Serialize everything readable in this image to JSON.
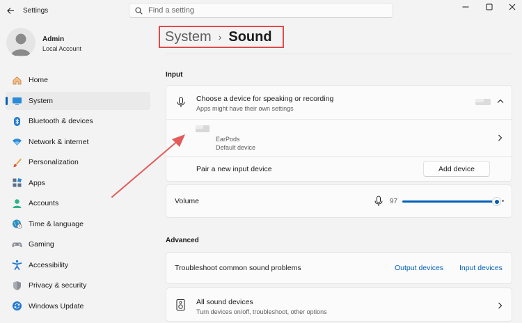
{
  "app": {
    "title": "Settings"
  },
  "search": {
    "placeholder": "Find a setting"
  },
  "account": {
    "name": "Admin",
    "type": "Local Account"
  },
  "sidebar": {
    "items": [
      {
        "label": "Home",
        "icon": "home-icon"
      },
      {
        "label": "System",
        "icon": "system-icon",
        "active": true
      },
      {
        "label": "Bluetooth & devices",
        "icon": "bluetooth-icon"
      },
      {
        "label": "Network & internet",
        "icon": "wifi-icon"
      },
      {
        "label": "Personalization",
        "icon": "brush-icon"
      },
      {
        "label": "Apps",
        "icon": "apps-icon"
      },
      {
        "label": "Accounts",
        "icon": "person-icon"
      },
      {
        "label": "Time & language",
        "icon": "globe-clock-icon"
      },
      {
        "label": "Gaming",
        "icon": "gamepad-icon"
      },
      {
        "label": "Accessibility",
        "icon": "accessibility-icon"
      },
      {
        "label": "Privacy & security",
        "icon": "shield-icon"
      },
      {
        "label": "Windows Update",
        "icon": "update-icon"
      }
    ]
  },
  "breadcrumb": {
    "parent": "System",
    "separator": "›",
    "current": "Sound"
  },
  "input": {
    "section_title": "Input",
    "choose_device": {
      "title": "Choose a device for speaking or recording",
      "subtitle": "Apps might have their own settings"
    },
    "device": {
      "name": "EarPods",
      "status": "Default device"
    },
    "pair": {
      "label": "Pair a new input device",
      "button": "Add device"
    },
    "volume": {
      "label": "Volume",
      "value": "97",
      "level": 0.97
    }
  },
  "advanced": {
    "section_title": "Advanced",
    "troubleshoot": {
      "label": "Troubleshoot common sound problems",
      "output_link": "Output devices",
      "input_link": "Input devices"
    },
    "all_devices": {
      "title": "All sound devices",
      "subtitle": "Turn devices on/off, troubleshoot, other options"
    }
  },
  "colors": {
    "accent": "#005fb8",
    "annotation": "#e04a4a"
  }
}
